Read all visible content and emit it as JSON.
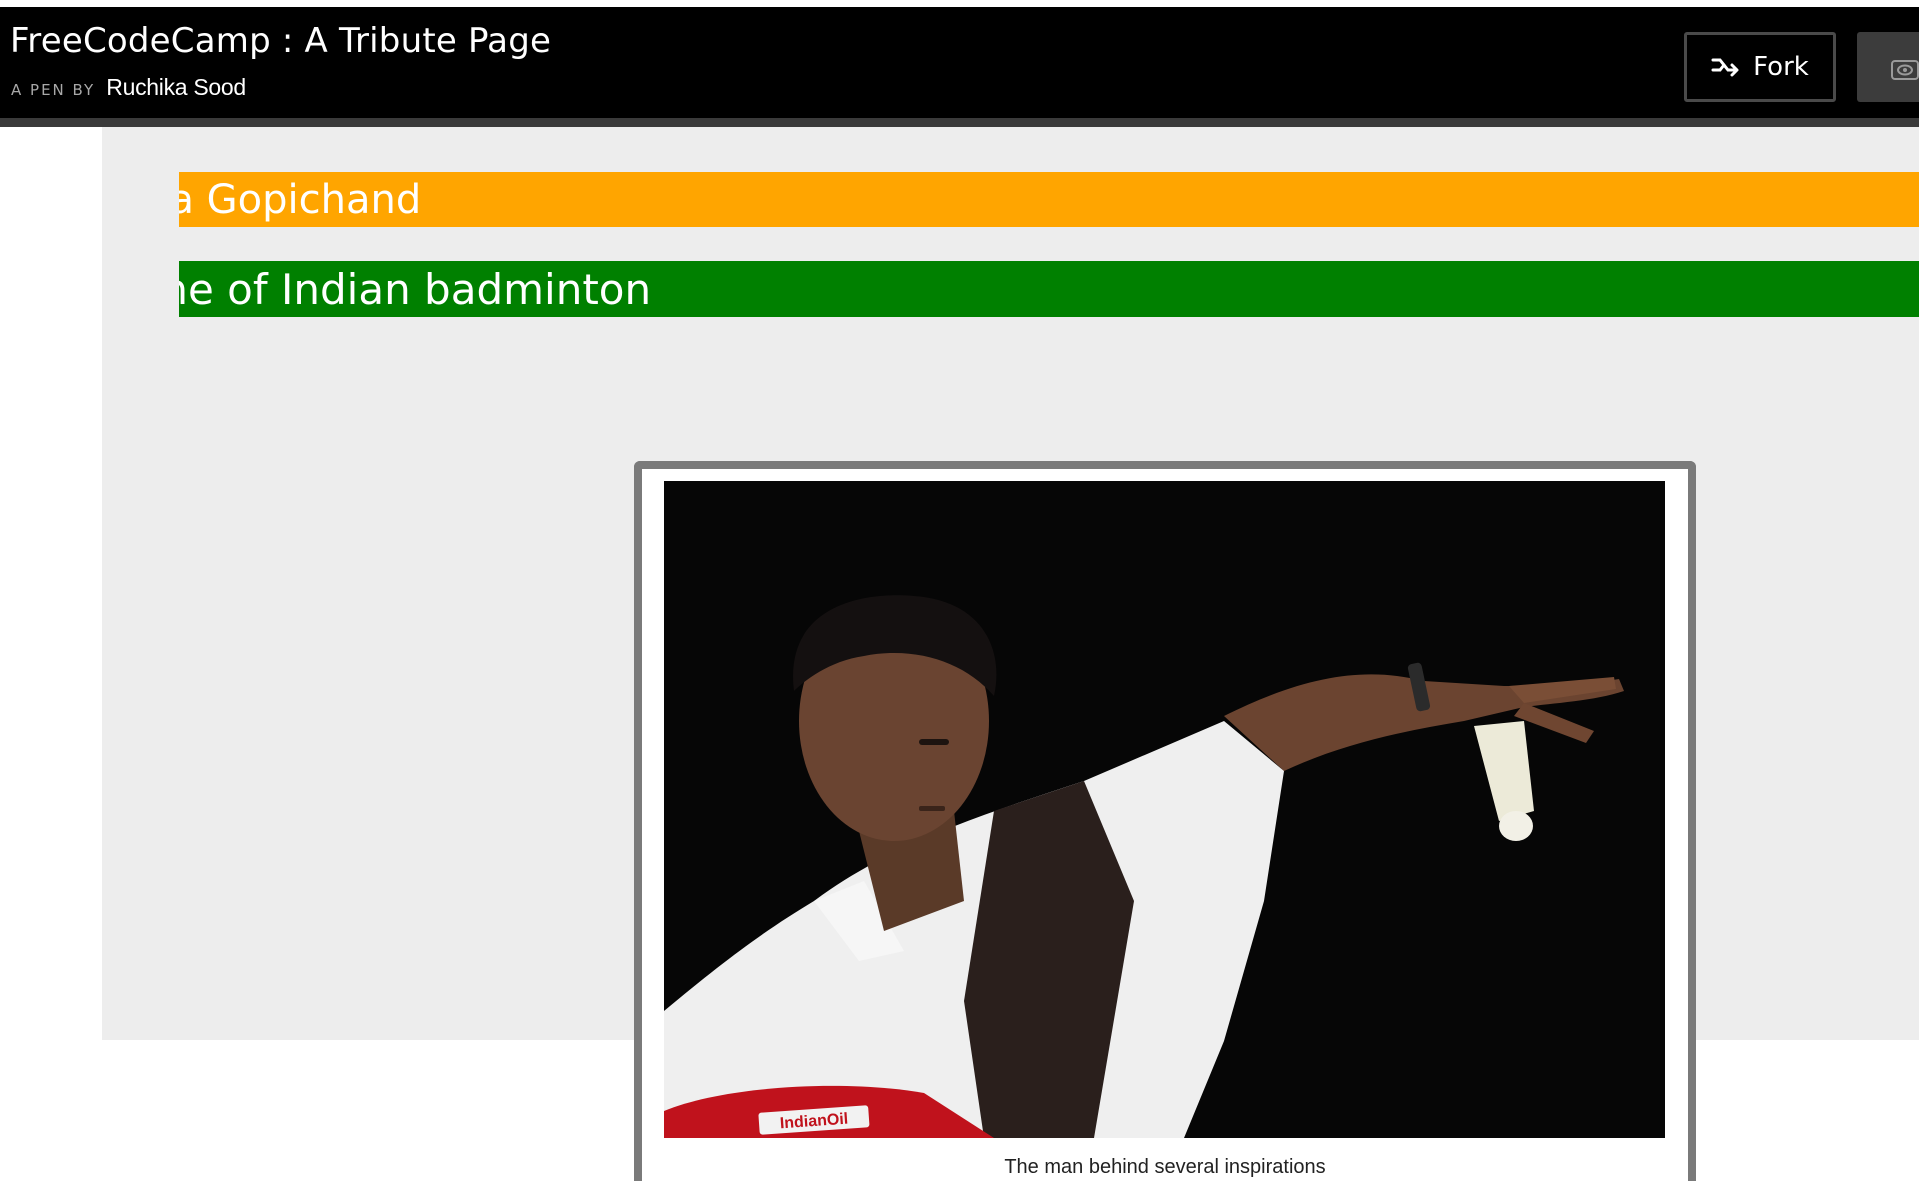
{
  "header": {
    "title": "FreeCodeCamp : A Tribute Page",
    "pen_by": "A PEN BY",
    "author": "Ruchika Sood",
    "fork_label": "Fork",
    "fork_icon": "fork-icon",
    "view_icon": "eye-icon"
  },
  "tribute": {
    "name": "Pullela Gopichand",
    "tagline": "Don Vito Corleone of Indian badminton",
    "image_caption": "The man behind several inspirations",
    "jersey_text": "IndianOil"
  },
  "colors": {
    "header_bg": "#000000",
    "content_bg": "#ededed",
    "name_banner": "#ffa500",
    "tagline_banner": "#008000",
    "frame_border": "#7a7a7a"
  }
}
